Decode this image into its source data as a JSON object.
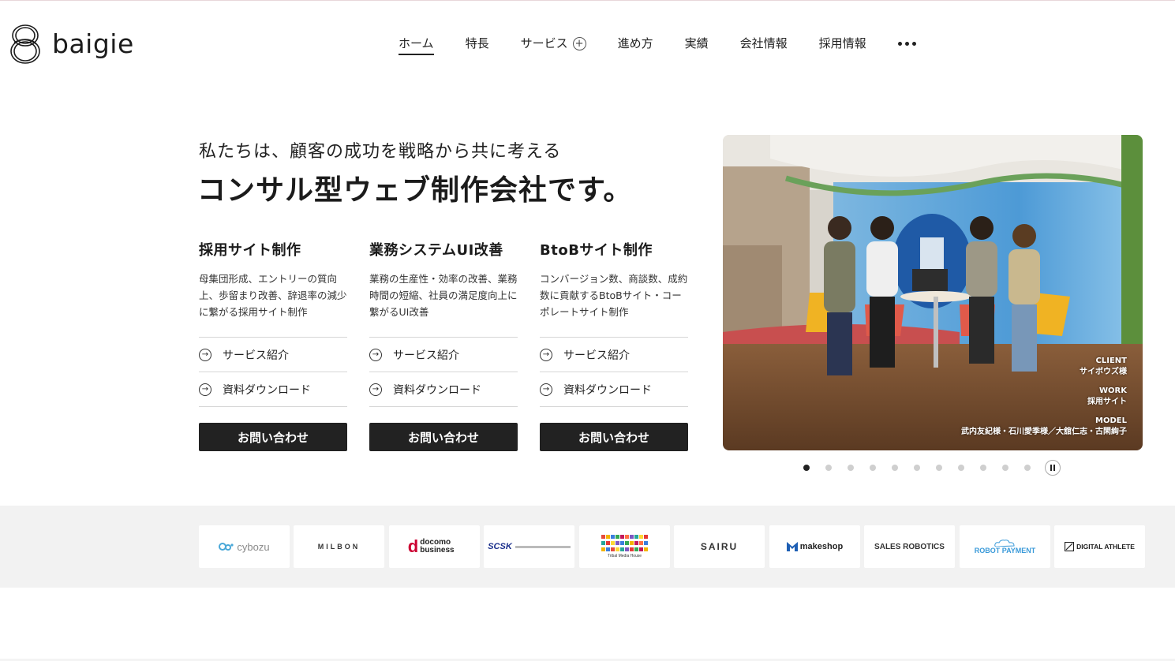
{
  "brand": {
    "name": "baigie"
  },
  "nav": {
    "items": [
      "ホーム",
      "特長",
      "サービス",
      "進め方",
      "実績",
      "会社情報",
      "採用情報"
    ],
    "active_index": 0
  },
  "hero": {
    "subtitle": "私たちは、顧客の成功を戦略から共に考える",
    "title": "コンサル型ウェブ制作会社です。"
  },
  "services": [
    {
      "title": "採用サイト制作",
      "desc": "母集団形成、エントリーの質向上、歩留まり改善、辞退率の減少に繋がる採用サイト制作",
      "links": [
        "サービス紹介",
        "資料ダウンロード"
      ],
      "cta": "お問い合わせ"
    },
    {
      "title": "業務システムUI改善",
      "desc": "業務の生産性・効率の改善、業務時間の短縮、社員の満足度向上に繋がるUI改善",
      "links": [
        "サービス紹介",
        "資料ダウンロード"
      ],
      "cta": "お問い合わせ"
    },
    {
      "title": "BtoBサイト制作",
      "desc": "コンバージョン数、商談数、成約数に貢献するBtoBサイト・コーポレートサイト制作",
      "links": [
        "サービス紹介",
        "資料ダウンロード"
      ],
      "cta": "お問い合わせ"
    }
  ],
  "slide": {
    "client_label": "CLIENT",
    "client": "サイボウズ様",
    "work_label": "WORK",
    "work": "採用サイト",
    "model_label": "MODEL",
    "model": "武内友紀様・石川愛季様／大舘仁志・古閑絢子"
  },
  "slider": {
    "total": 12,
    "active_index": 0
  },
  "clients": [
    "cybozu",
    "MILBON",
    "docomo business",
    "SCSK",
    "Tribal Media House",
    "SAIRU",
    "makeshop",
    "SALES ROBOTICS",
    "ROBOT PAYMENT",
    "DIGITAL ATHLETE"
  ],
  "colors": {
    "text": "#222222",
    "button_bg": "#222222",
    "clients_bg": "#f2f2f2",
    "docomo_red": "#cc0033",
    "scsk_blue": "#1a2f8c"
  }
}
